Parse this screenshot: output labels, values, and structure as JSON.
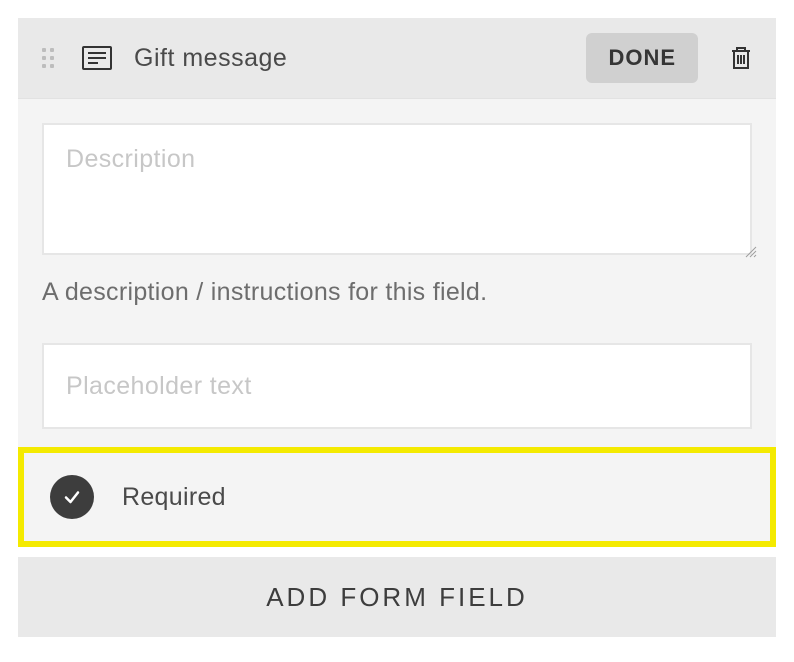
{
  "header": {
    "title": "Gift message",
    "done_label": "DONE"
  },
  "body": {
    "description_value": "",
    "description_placeholder": "Description",
    "description_help": "A description / instructions for this field.",
    "placeholder_value": "",
    "placeholder_placeholder": "Placeholder text",
    "required_label": "Required",
    "required_checked": true
  },
  "footer": {
    "add_field_label": "ADD FORM FIELD"
  }
}
